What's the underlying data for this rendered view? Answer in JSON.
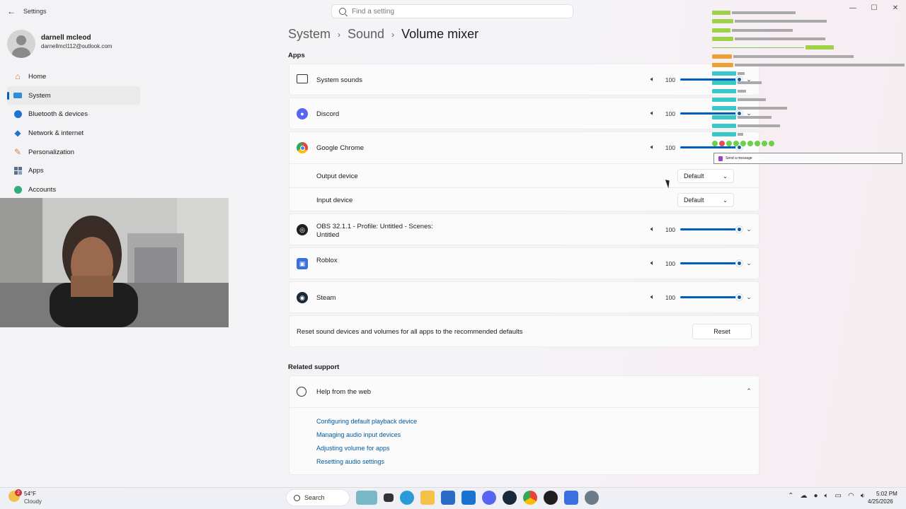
{
  "window": {
    "title": "Settings",
    "search_placeholder": "Find a setting",
    "minimize": "—",
    "maximize": "☐",
    "close": "✕"
  },
  "user": {
    "name": "darnell mcleod",
    "email": "darnellmcl112@outlook.com"
  },
  "sidebar": {
    "items": [
      {
        "label": "Home",
        "icon": "home-icon"
      },
      {
        "label": "System",
        "icon": "system-icon",
        "active": true
      },
      {
        "label": "Bluetooth & devices",
        "icon": "bluetooth-icon"
      },
      {
        "label": "Network & internet",
        "icon": "wifi-icon"
      },
      {
        "label": "Personalization",
        "icon": "brush-icon"
      },
      {
        "label": "Apps",
        "icon": "apps-icon"
      },
      {
        "label": "Accounts",
        "icon": "accounts-icon"
      }
    ]
  },
  "breadcrumb": {
    "level1": "System",
    "level2": "Sound",
    "current": "Volume mixer"
  },
  "apps_section": {
    "label": "Apps",
    "rows": [
      {
        "name": "System sounds",
        "volume": "100"
      },
      {
        "name": "Discord",
        "volume": "100"
      },
      {
        "name": "Google Chrome",
        "volume": "100"
      },
      {
        "name": "OBS 32.1.1 - Profile: Untitled - Scenes:",
        "name2": "Untitled",
        "volume": "100"
      },
      {
        "name": "Roblox",
        "volume": "100"
      },
      {
        "name": "Steam",
        "volume": "100"
      }
    ],
    "chrome_output_label": "Output device",
    "chrome_output_value": "Default",
    "chrome_input_label": "Input device",
    "chrome_input_value": "Default"
  },
  "reset": {
    "text": "Reset sound devices and volumes for all apps to the recommended defaults",
    "button": "Reset"
  },
  "related_support": {
    "label": "Related support",
    "help_title": "Help from the web",
    "links": [
      "Configuring default playback device",
      "Managing audio input devices",
      "Adjusting volume for apps",
      "Resetting audio settings"
    ]
  },
  "chat": {
    "input_placeholder": "Send a message"
  },
  "taskbar": {
    "weather_temp": "54°F",
    "weather_desc": "Cloudy",
    "weather_badge": "2",
    "search": "Search",
    "time": "5:02 PM",
    "date": "4/25/2026"
  },
  "colors": {
    "accent": "#005fb8",
    "link": "#005a9e"
  }
}
